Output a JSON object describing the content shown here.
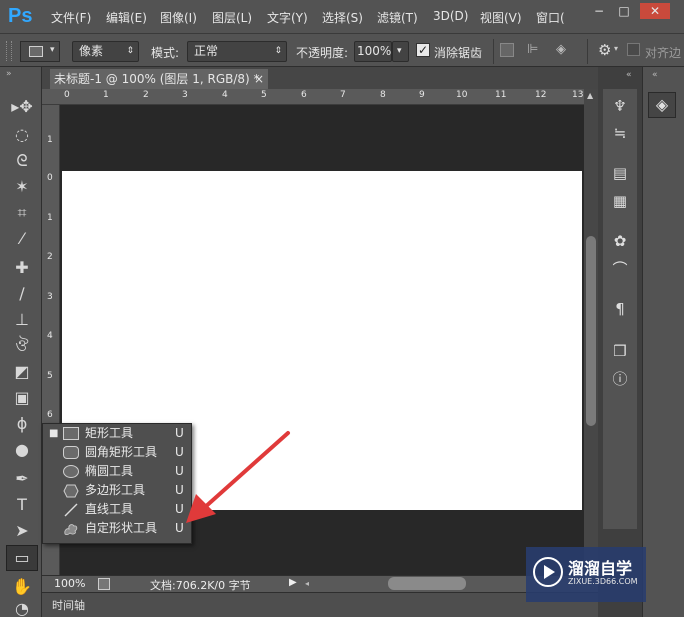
{
  "app": {
    "logo": "Ps"
  },
  "menu": {
    "items": [
      "文件(F)",
      "编辑(E)",
      "图像(I)",
      "图层(L)",
      "文字(Y)",
      "选择(S)",
      "滤镜(T)",
      "3D(D)",
      "视图(V)",
      "窗口("
    ],
    "window_controls": [
      "−",
      "□",
      "✕"
    ]
  },
  "options": {
    "unit_value": "像素",
    "mode_label": "模式:",
    "mode_value": "正常",
    "opacity_label": "不透明度:",
    "opacity_value": "100%",
    "antialias_label": "消除锯齿",
    "antialias_checked": true,
    "align_edges_label": "对齐边"
  },
  "document": {
    "tab_title": "未标题-1 @ 100% (图层 1, RGB/8) *",
    "close_glyph": "×"
  },
  "rulers": {
    "top": [
      "0",
      "1",
      "2",
      "3",
      "4",
      "5",
      "6",
      "7",
      "8",
      "9",
      "10",
      "11",
      "12",
      "13"
    ],
    "left": [
      "1",
      "0",
      "1",
      "2",
      "3",
      "4",
      "5",
      "6"
    ]
  },
  "status": {
    "zoom": "100%",
    "doc_info": "文档:706.2K/0 字节"
  },
  "timeline": {
    "label": "时间轴"
  },
  "tools": [
    "move-tool-icon",
    "marquee-icon",
    "lasso-icon",
    "magic-wand-icon",
    "crop-icon",
    "eyedropper-icon",
    "healing-icon",
    "brush-icon",
    "stamp-icon",
    "history-brush-icon",
    "eraser-icon",
    "gradient-icon",
    "blur-icon",
    "dodge-icon",
    "pen-icon",
    "type-icon",
    "path-select-icon",
    "rectangle-tool-icon",
    "hand-icon",
    "zoom-icon"
  ],
  "shape_menu": {
    "items": [
      {
        "label": "矩形工具",
        "key": "U",
        "selected": true,
        "icon": "rectangle-icon"
      },
      {
        "label": "圆角矩形工具",
        "key": "U",
        "selected": false,
        "icon": "rounded-rectangle-icon"
      },
      {
        "label": "椭圆工具",
        "key": "U",
        "selected": false,
        "icon": "ellipse-icon"
      },
      {
        "label": "多边形工具",
        "key": "U",
        "selected": false,
        "icon": "polygon-icon"
      },
      {
        "label": "直线工具",
        "key": "U",
        "selected": false,
        "icon": "line-icon"
      },
      {
        "label": "自定形状工具",
        "key": "U",
        "selected": false,
        "icon": "custom-shape-icon"
      }
    ]
  },
  "watermark": {
    "title": "溜溜自学",
    "url": "ZIXUE.3D66.COM"
  },
  "colors": {
    "accent_arrow": "#e03a3a",
    "logo_blue": "#31a8ff",
    "panel_bg": "#535353",
    "canvas": "#ffffff"
  }
}
